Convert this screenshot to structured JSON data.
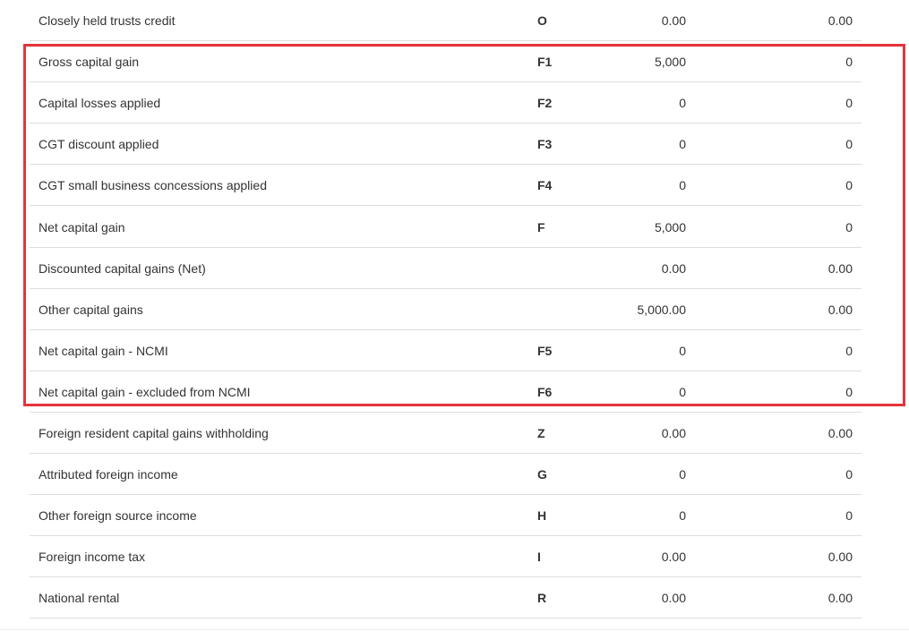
{
  "rows": [
    {
      "label": "Closely held trusts credit",
      "code": "O",
      "v1": "0.00",
      "v2": "0.00"
    },
    {
      "label": "Gross capital gain",
      "code": "F1",
      "v1": "5,000",
      "v2": "0"
    },
    {
      "label": "Capital losses applied",
      "code": "F2",
      "v1": "0",
      "v2": "0"
    },
    {
      "label": "CGT discount applied",
      "code": "F3",
      "v1": "0",
      "v2": "0"
    },
    {
      "label": "CGT small business concessions applied",
      "code": "F4",
      "v1": "0",
      "v2": "0"
    },
    {
      "label": "Net capital gain",
      "code": "F",
      "v1": "5,000",
      "v2": "0"
    },
    {
      "label": "Discounted capital gains (Net)",
      "code": "",
      "v1": "0.00",
      "v2": "0.00"
    },
    {
      "label": "Other capital gains",
      "code": "",
      "v1": "5,000.00",
      "v2": "0.00"
    },
    {
      "label": "Net capital gain - NCMI",
      "code": "F5",
      "v1": "0",
      "v2": "0"
    },
    {
      "label": "Net capital gain - excluded from NCMI",
      "code": "F6",
      "v1": "0",
      "v2": "0"
    },
    {
      "label": "Foreign resident capital gains withholding",
      "code": "Z",
      "v1": "0.00",
      "v2": "0.00"
    },
    {
      "label": "Attributed foreign income",
      "code": "G",
      "v1": "0",
      "v2": "0"
    },
    {
      "label": "Other foreign source income",
      "code": "H",
      "v1": "0",
      "v2": "0"
    },
    {
      "label": "Foreign income tax",
      "code": "I",
      "v1": "0.00",
      "v2": "0.00"
    },
    {
      "label": "National rental",
      "code": "R",
      "v1": "0.00",
      "v2": "0.00"
    }
  ],
  "highlight_color": "#e4343b"
}
